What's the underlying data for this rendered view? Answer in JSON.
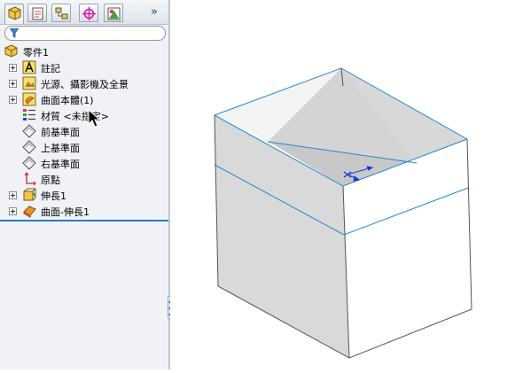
{
  "panel": {
    "tabs": [
      {
        "name": "feature-manager",
        "icon": "feature-manager-icon",
        "active": true
      },
      {
        "name": "property-manager",
        "icon": "property-manager-icon"
      },
      {
        "name": "configuration-manager",
        "icon": "configuration-manager-icon"
      },
      {
        "name": "dimxpert-manager",
        "icon": "dimxpert-icon"
      },
      {
        "name": "display-manager",
        "icon": "display-manager-icon"
      }
    ],
    "more_label": "»",
    "filter_icon": "filter-icon"
  },
  "tree": {
    "root": {
      "label": "零件1",
      "icon": "part-icon"
    },
    "items": [
      {
        "label": "註記",
        "icon": "annotation-icon",
        "expandable": true
      },
      {
        "label": "光源、攝影機及全景",
        "icon": "lights-cameras-icon",
        "expandable": true
      },
      {
        "label": "曲面本體(1)",
        "icon": "surface-bodies-icon",
        "expandable": true
      },
      {
        "label": "材質 <未指定>",
        "icon": "material-icon",
        "expandable": false
      },
      {
        "label": "前基準面",
        "icon": "plane-icon",
        "expandable": false
      },
      {
        "label": "上基準面",
        "icon": "plane-icon",
        "expandable": false
      },
      {
        "label": "右基準面",
        "icon": "plane-icon",
        "expandable": false
      },
      {
        "label": "原點",
        "icon": "origin-icon",
        "expandable": false
      },
      {
        "label": "伸長1",
        "icon": "extrude-icon",
        "expandable": true
      },
      {
        "label": "曲面-伸長1",
        "icon": "surface-extrude-icon",
        "expandable": true
      }
    ]
  },
  "viewport": {
    "model": "open-top surface box",
    "edge_color": "#1e8ad2",
    "face_light": "#ffffff",
    "face_shaded": "#d6d6d6",
    "face_inner": "#c9c9c9"
  },
  "colors": {
    "panel_bg": "#f0f2f6",
    "accent": "#2c78c7"
  }
}
